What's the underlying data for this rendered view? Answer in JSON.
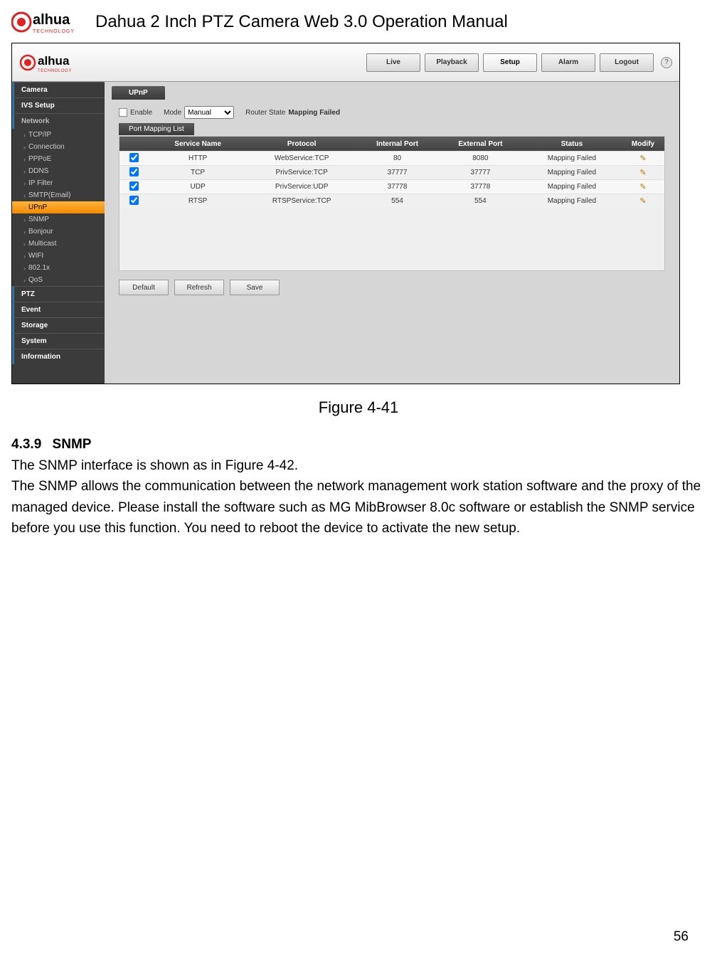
{
  "header": {
    "logo_text": "alhua",
    "logo_sub": "TECHNOLOGY",
    "title": "Dahua 2 Inch PTZ Camera Web 3.0 Operation Manual"
  },
  "screenshot": {
    "logo_text": "alhua",
    "tabs": [
      "Live",
      "Playback",
      "Setup",
      "Alarm",
      "Logout"
    ],
    "active_tab": "Setup",
    "help": "?",
    "sidebar_sections": [
      "Camera",
      "IVS Setup",
      "Network"
    ],
    "sidebar_subs": [
      "TCP/IP",
      "Connection",
      "PPPoE",
      "DDNS",
      "IP Filter",
      "SMTP(Email)",
      "UPnP",
      "SNMP",
      "Bonjour",
      "Multicast",
      "WIFI",
      "802.1x",
      "QoS"
    ],
    "sidebar_subs_active": "UPnP",
    "sidebar_sections_after": [
      "PTZ",
      "Event",
      "Storage",
      "System",
      "Information"
    ],
    "panel_tab": "UPnP",
    "enable_label": "Enable",
    "mode_label": "Mode",
    "mode_value": "Manual",
    "router_state_label": "Router State",
    "router_state_value": "Mapping Failed",
    "subtab": "Port Mapping List",
    "columns": [
      "",
      "Service Name",
      "Protocol",
      "Internal Port",
      "External Port",
      "Status",
      "Modify"
    ],
    "rows": [
      {
        "checked": true,
        "service": "HTTP",
        "protocol": "WebService:TCP",
        "iport": "80",
        "eport": "8080",
        "status": "Mapping Failed"
      },
      {
        "checked": true,
        "service": "TCP",
        "protocol": "PrivService:TCP",
        "iport": "37777",
        "eport": "37777",
        "status": "Mapping Failed"
      },
      {
        "checked": true,
        "service": "UDP",
        "protocol": "PrivService:UDP",
        "iport": "37778",
        "eport": "37778",
        "status": "Mapping Failed"
      },
      {
        "checked": true,
        "service": "RTSP",
        "protocol": "RTSPService:TCP",
        "iport": "554",
        "eport": "554",
        "status": "Mapping Failed"
      }
    ],
    "buttons": [
      "Default",
      "Refresh",
      "Save"
    ]
  },
  "figure_caption": "Figure 4-41",
  "section": {
    "number": "4.3.9",
    "title": "SNMP",
    "para1": "The SNMP interface is shown as in Figure 4-42.",
    "para2": "The SNMP allows the communication between the network management work station software and the proxy of the managed device. Please install the software such as MG MibBrowser 8.0c software or establish the SNMP service before you use this function. You need to reboot the device to activate the new setup."
  },
  "page_number": "56"
}
